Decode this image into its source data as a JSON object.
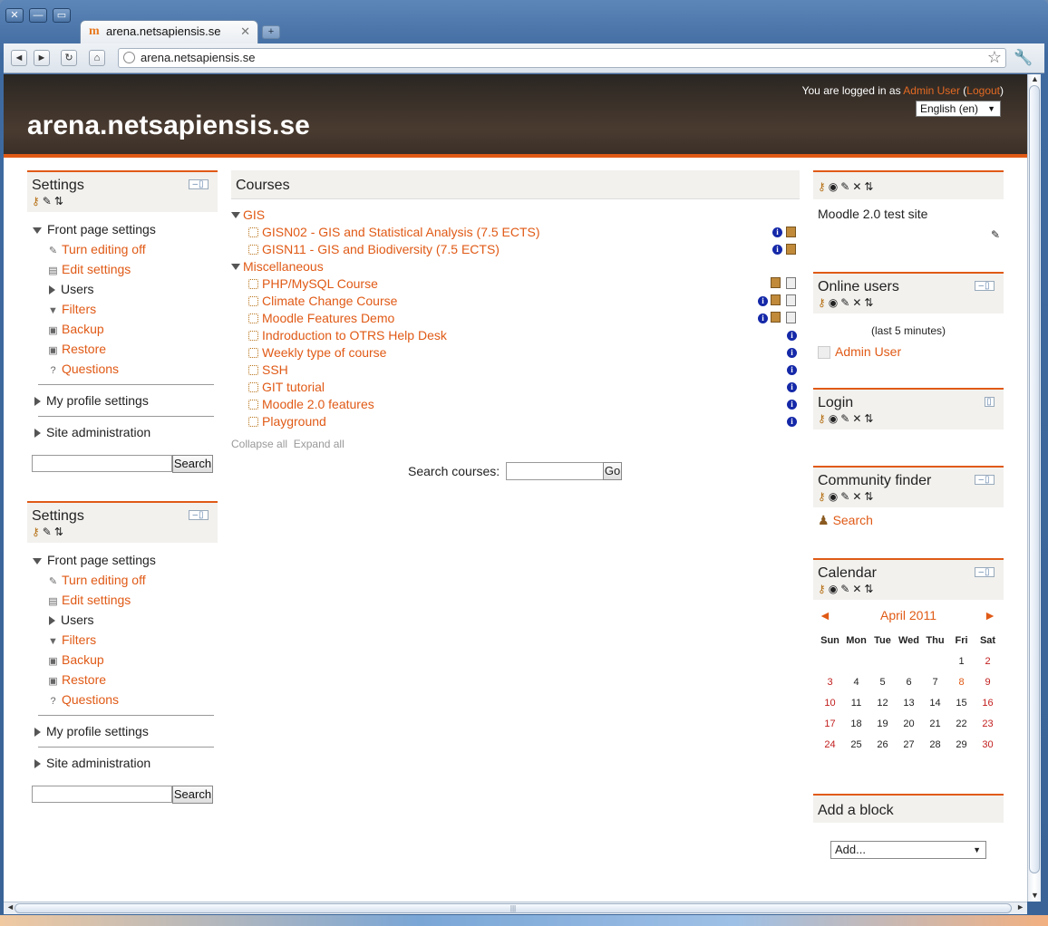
{
  "browser": {
    "tab_title": "arena.netsapiensis.se",
    "url": "arena.netsapiensis.se",
    "new_tab_label": "+",
    "icons": [
      "close-icon",
      "minimize-icon",
      "maximize-icon",
      "back-icon",
      "forward-icon",
      "reload-icon",
      "home-icon",
      "globe-icon",
      "star-icon",
      "wrench-icon"
    ]
  },
  "header": {
    "site_name": "arena.netsapiensis.se",
    "logged_in_prefix": "You are logged in as ",
    "user_name": "Admin User",
    "logout_label": "Logout",
    "language": "English (en)",
    "accent_color": "#e05a16"
  },
  "settings_block": {
    "title": "Settings",
    "front_page_settings": "Front page settings",
    "turn_editing_off": "Turn editing off",
    "edit_settings": "Edit settings",
    "users": "Users",
    "filters": "Filters",
    "backup": "Backup",
    "restore": "Restore",
    "questions": "Questions",
    "my_profile_settings": "My profile settings",
    "site_administration": "Site administration",
    "search_button": "Search"
  },
  "courses": {
    "title": "Courses",
    "categories": [
      {
        "name": "GIS",
        "courses": [
          "GISN02 - GIS and Statistical Analysis (7.5 ECTS)",
          "GISN11 - GIS and Biodiversity (7.5 ECTS)"
        ]
      },
      {
        "name": "Miscellaneous",
        "courses": [
          "PHP/MySQL Course",
          "Climate Change Course",
          "Moodle Features Demo",
          "Indroduction to OTRS Help Desk",
          "Weekly type of course",
          "SSH",
          "GIT tutorial",
          "Moodle 2.0 features",
          "Playground"
        ]
      }
    ],
    "collapse_all": "Collapse all",
    "expand_all": "Expand all",
    "search_label": "Search courses:",
    "go_button": "Go"
  },
  "site_block": {
    "text": "Moodle 2.0 test site"
  },
  "online_users": {
    "title": "Online users",
    "subtitle": "(last 5 minutes)",
    "user": "Admin User"
  },
  "login_block": {
    "title": "Login"
  },
  "community_finder": {
    "title": "Community finder",
    "search": "Search"
  },
  "calendar": {
    "title": "Calendar",
    "prev": "◄",
    "next": "►",
    "month": "April 2011",
    "days": [
      "Sun",
      "Mon",
      "Tue",
      "Wed",
      "Thu",
      "Fri",
      "Sat"
    ],
    "weeks": [
      [
        "",
        "",
        "",
        "",
        "",
        "1",
        "2"
      ],
      [
        "3",
        "4",
        "5",
        "6",
        "7",
        "8",
        "9"
      ],
      [
        "10",
        "11",
        "12",
        "13",
        "14",
        "15",
        "16"
      ],
      [
        "17",
        "18",
        "19",
        "20",
        "21",
        "22",
        "23"
      ],
      [
        "24",
        "25",
        "26",
        "27",
        "28",
        "29",
        "30"
      ]
    ],
    "event_day": "8"
  },
  "add_block": {
    "title": "Add a block",
    "select_value": "Add..."
  }
}
